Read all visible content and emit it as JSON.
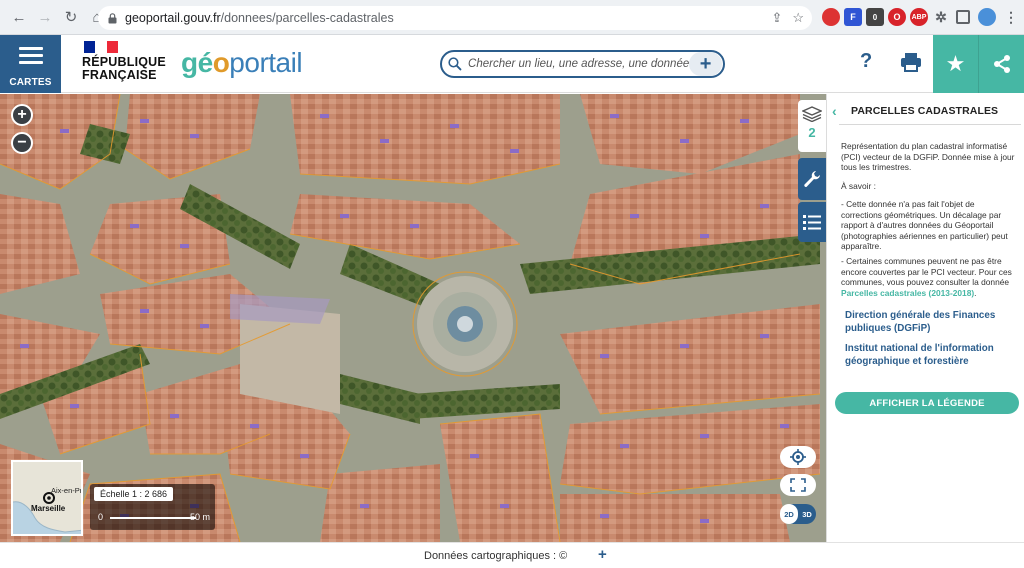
{
  "browser": {
    "url_host": "geoportail.gouv.fr",
    "url_path": "/donnees/parcelles-cadastrales",
    "extension_badge": "0"
  },
  "header": {
    "menu_label": "CARTES",
    "rf_line1": "RÉPUBLIQUE",
    "rf_line2": "FRANÇAISE",
    "logo_geo_start": "gé",
    "logo_geo_o": "o",
    "logo_portail": "portail",
    "search_placeholder": "Chercher un lieu, une adresse, une donnée",
    "help_label": "?",
    "colors": {
      "primary": "#2b5d8c",
      "accent": "#46b7a4",
      "logo_orange": "#e09a2a"
    }
  },
  "map": {
    "zoom_in": "+",
    "zoom_out": "−",
    "scale_text": "Échelle 1 : 2 686",
    "scale_zero": "0",
    "scale_distance": "50 m",
    "minimap_label_1": "Aix-en-Pr",
    "minimap_label_2": "Marseille",
    "mode_2d": "2D",
    "mode_3d": "3D",
    "active_mode": "2D"
  },
  "side_tabs": {
    "layers_count": "2"
  },
  "panel": {
    "title": "PARCELLES CADASTRALES",
    "description": "Représentation du plan cadastral informatisé (PCI) vecteur de la DGFiP. Donnée mise à jour tous les trimestres.",
    "know_label": "À savoir :",
    "note_1": "- Cette donnée n'a pas fait l'objet de corrections géométriques. Un décalage par rapport à d'autres données du Géoportail (photographies aériennes en particulier) peut apparaître.",
    "note_2_text": "- Certaines communes peuvent ne pas être encore couvertes par le PCI vecteur. Pour ces communes, vous pouvez consulter la donnée",
    "note_2_link": "Parcelles cadastrales (2013-2018)",
    "note_2_end": ".",
    "link_dgfip": "Direction générale des Finances publiques (DGFiP)",
    "link_ign": "Institut national de l'information géographique et forestière",
    "legend_button": "AFFICHER LA LÉGENDE"
  },
  "footer": {
    "credits": "Données cartographiques : ©",
    "expand": "+"
  }
}
